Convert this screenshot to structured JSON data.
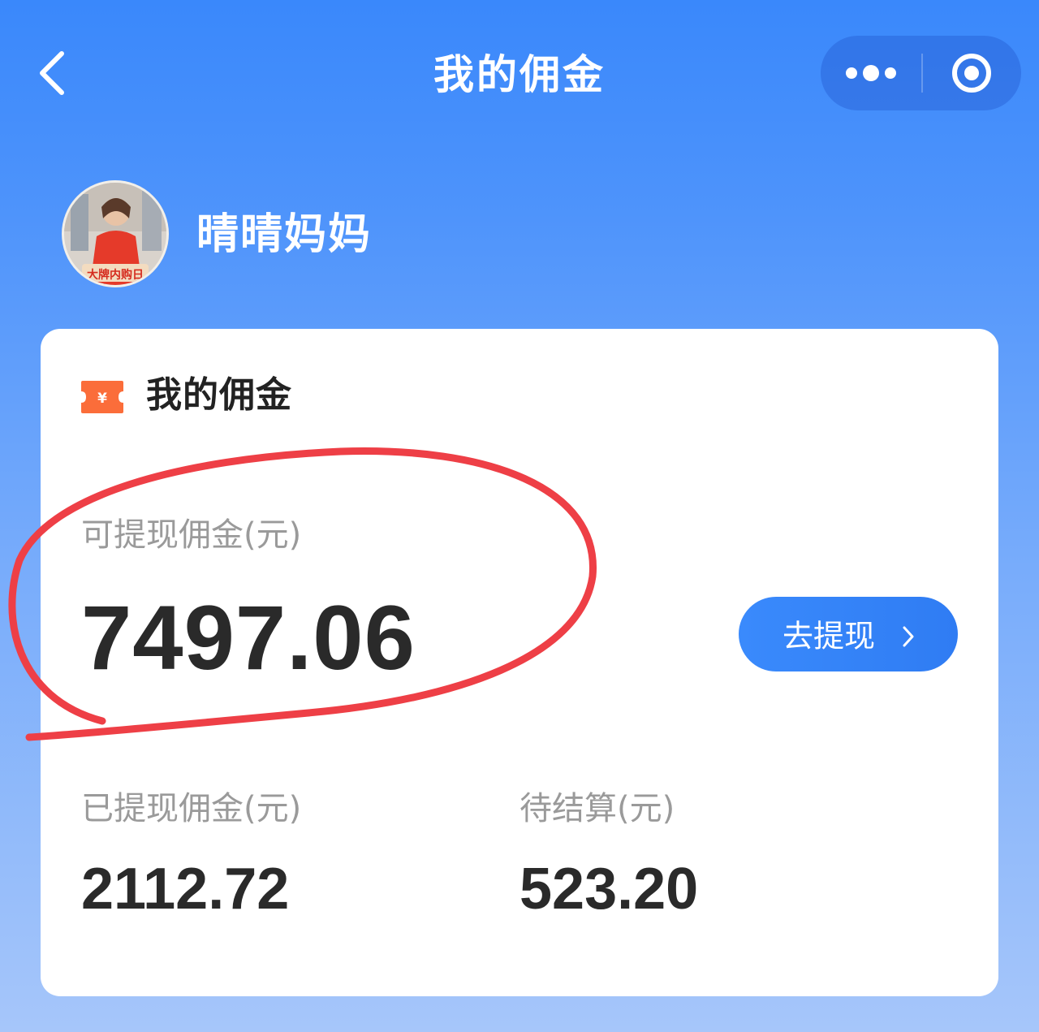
{
  "nav": {
    "title": "我的佣金",
    "back_icon": "chevron-left-icon",
    "more_icon": "more-dots-icon",
    "close_icon": "target-circle-icon"
  },
  "user": {
    "name": "晴晴妈妈",
    "avatar_badge": "大牌内购日"
  },
  "card": {
    "title": "我的佣金",
    "icon": "yuan-ticket-icon",
    "available": {
      "label": "可提现佣金(元)",
      "value": "7497.06"
    },
    "withdraw_button": "去提现",
    "withdrawn": {
      "label": "已提现佣金(元)",
      "value": "2112.72"
    },
    "pending": {
      "label": "待结算(元)",
      "value": "523.20"
    }
  },
  "colors": {
    "primary_blue": "#3a88fb",
    "button_blue": "#2f7cf3",
    "ticket_orange": "#fb6d3a",
    "annotation_red": "#ee3f46"
  }
}
